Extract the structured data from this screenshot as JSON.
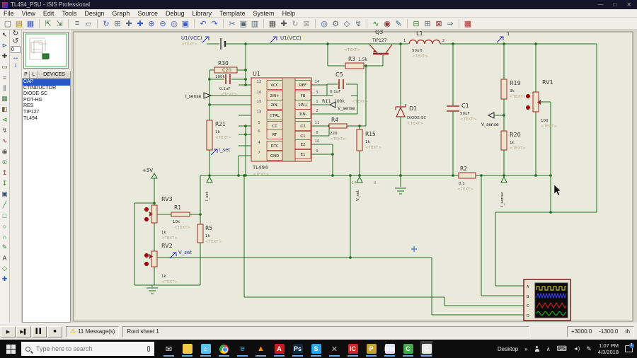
{
  "window": {
    "title": "TL494_PSU - ISIS Professional",
    "controls": {
      "minimize": "—",
      "maximize": "□",
      "close": "✕"
    }
  },
  "menu": {
    "items": [
      "File",
      "View",
      "Edit",
      "Tools",
      "Design",
      "Graph",
      "Source",
      "Debug",
      "Library",
      "Template",
      "System",
      "Help"
    ]
  },
  "toolbar": {
    "icons": [
      {
        "name": "new-design-icon",
        "glyph": "▢"
      },
      {
        "name": "open-design-icon",
        "glyph": "▤",
        "color": "#b58900"
      },
      {
        "name": "save-design-icon",
        "glyph": "▦",
        "color": "#3b5bd0"
      },
      {
        "name": "separator"
      },
      {
        "name": "import-section-icon",
        "glyph": "⇱",
        "color": "#447744"
      },
      {
        "name": "export-section-icon",
        "glyph": "⇲",
        "color": "#447744"
      },
      {
        "name": "separator"
      },
      {
        "name": "print-icon",
        "glyph": "≡"
      },
      {
        "name": "mark-output-area-icon",
        "glyph": "▱"
      },
      {
        "name": "separator"
      },
      {
        "name": "redraw-icon",
        "glyph": "↻",
        "color": "#3b5bd0"
      },
      {
        "name": "toggle-grid-icon",
        "glyph": "⊞"
      },
      {
        "name": "false-origin-icon",
        "glyph": "✚"
      },
      {
        "name": "center-at-cursor-icon",
        "glyph": "✚",
        "color": "#3b5bd0"
      },
      {
        "name": "zoom-in-icon",
        "glyph": "⊕",
        "color": "#3b5bd0"
      },
      {
        "name": "zoom-out-icon",
        "glyph": "⊖",
        "color": "#3b5bd0"
      },
      {
        "name": "zoom-all-icon",
        "glyph": "◎",
        "color": "#3b5bd0"
      },
      {
        "name": "zoom-area-icon",
        "glyph": "▣",
        "color": "#3b5bd0"
      },
      {
        "name": "separator"
      },
      {
        "name": "undo-icon",
        "glyph": "↶",
        "color": "#3b5bd0"
      },
      {
        "name": "redo-icon",
        "glyph": "↷",
        "color": "#3b5bd0"
      },
      {
        "name": "separator"
      },
      {
        "name": "cut-icon",
        "glyph": "✂"
      },
      {
        "name": "copy-icon",
        "glyph": "▣"
      },
      {
        "name": "paste-icon",
        "glyph": "▥"
      },
      {
        "name": "separator"
      },
      {
        "name": "block-copy-icon",
        "glyph": "▦",
        "color": "#555555"
      },
      {
        "name": "block-move-icon",
        "glyph": "✚",
        "color": "#555555"
      },
      {
        "name": "block-rotate-icon",
        "glyph": "↻",
        "color": "#9a9a9a"
      },
      {
        "name": "block-delete-icon",
        "glyph": "⊠",
        "color": "#9a9a9a"
      },
      {
        "name": "separator"
      },
      {
        "name": "pick-parts-icon",
        "glyph": "◎",
        "color": "#3b5bd0"
      },
      {
        "name": "make-device-icon",
        "glyph": "⚙"
      },
      {
        "name": "packaging-tool-icon",
        "glyph": "◇"
      },
      {
        "name": "decompose-icon",
        "glyph": "↯"
      },
      {
        "name": "separator"
      },
      {
        "name": "wire-autorouter-icon",
        "glyph": "∿",
        "color": "#2e8b2e"
      },
      {
        "name": "search-tag-icon",
        "glyph": "◉",
        "color": "#8b2e2e"
      },
      {
        "name": "property-assignment-icon",
        "glyph": "✎",
        "color": "#2e6e8b"
      },
      {
        "name": "separator"
      },
      {
        "name": "design-explorer-icon",
        "glyph": "⊟",
        "color": "#2e8b2e"
      },
      {
        "name": "new-sheet-icon",
        "glyph": "⊞"
      },
      {
        "name": "remove-sheet-icon",
        "glyph": "⊠",
        "color": "#8b2e2e"
      },
      {
        "name": "goto-sheet-icon",
        "glyph": "⇒"
      },
      {
        "name": "separator"
      },
      {
        "name": "netlist-to-ares-icon",
        "glyph": "▦",
        "color": "#c02020"
      }
    ]
  },
  "side_tools": {
    "angle": "0",
    "icons": [
      {
        "name": "rotate-clockwise-icon",
        "glyph": "↻"
      },
      {
        "name": "rotate-anticlockwise-icon",
        "glyph": "↺"
      }
    ],
    "mirror": [
      {
        "name": "mirror-horizontal-icon",
        "glyph": "↔"
      },
      {
        "name": "mirror-vertical-icon",
        "glyph": "↕"
      }
    ]
  },
  "mode_toolbar": {
    "icons": [
      {
        "name": "selection-mode-icon",
        "glyph": "↖",
        "color": "#111111"
      },
      {
        "name": "component-mode-icon",
        "glyph": "⊳",
        "color": "#33507a"
      },
      {
        "name": "junction-dot-icon",
        "glyph": "✚",
        "color": "#444444"
      },
      {
        "name": "wire-label-icon",
        "glyph": "▭",
        "color": "#6a6a3a"
      },
      {
        "name": "text-script-icon",
        "glyph": "≡",
        "color": "#777777"
      },
      {
        "name": "buses-icon",
        "glyph": "∥",
        "color": "#2a55c4"
      },
      {
        "name": "subcircuit-icon",
        "glyph": "▦",
        "color": "#447744"
      },
      {
        "name": "device-icon",
        "glyph": "◧",
        "color": "#7a5a2a"
      },
      {
        "name": "terminal-icon",
        "glyph": "⊲",
        "color": "#2e7d32"
      },
      {
        "name": "device-pin-icon",
        "glyph": "↯",
        "color": "#555555"
      },
      {
        "name": "graph-mode-icon",
        "glyph": "∿",
        "color": "#8b2e2e"
      },
      {
        "name": "tape-recorder-icon",
        "glyph": "◉",
        "color": "#555555"
      },
      {
        "name": "generator-icon",
        "glyph": "⊙",
        "color": "#2e7d32"
      },
      {
        "name": "voltage-probe-icon",
        "glyph": "↥",
        "color": "#8b2e2e"
      },
      {
        "name": "current-probe-icon",
        "glyph": "↧",
        "color": "#2e7d32"
      },
      {
        "name": "virtual-instrument-icon",
        "glyph": "▣",
        "color": "#33507a"
      },
      {
        "name": "2d-line-icon",
        "glyph": "╱",
        "color": "#2e7d32"
      },
      {
        "name": "2d-box-icon",
        "glyph": "□",
        "color": "#2e7d32"
      },
      {
        "name": "2d-circle-icon",
        "glyph": "○",
        "color": "#2e7d32"
      },
      {
        "name": "2d-arc-icon",
        "glyph": "∩",
        "color": "#2e7d32"
      },
      {
        "name": "2d-path-icon",
        "glyph": "✎",
        "color": "#2e7d32"
      },
      {
        "name": "2d-text-icon",
        "glyph": "A",
        "color": "#333333"
      },
      {
        "name": "2d-symbol-icon",
        "glyph": "◇",
        "color": "#2e7d32"
      },
      {
        "name": "2d-marker-icon",
        "glyph": "✚",
        "color": "#2a55c4"
      }
    ]
  },
  "object_selector": {
    "pick_button": "P",
    "library_button": "L",
    "header": "DEVICES",
    "devices": [
      {
        "label": "CAP",
        "selected": true
      },
      {
        "label": "CTINDUCTOR"
      },
      {
        "label": "DIODE-SC"
      },
      {
        "label": "POT-HG"
      },
      {
        "label": "RES"
      },
      {
        "label": "TIP127"
      },
      {
        "label": "TL494"
      }
    ]
  },
  "schematic": {
    "placeholder": "<TEXT>",
    "labels": {
      "vcc_left": "U1(VCC)",
      "vcc_mid": "U1(VCC)",
      "i_sense_in": "I_sense",
      "v_sense_fb": "V_sense",
      "v_sense_out": "V_sense",
      "i_set": "I_set",
      "v_set": "V_set",
      "plus5v": "+5V",
      "out_terminal": "1",
      "t_i_set": "I_set",
      "t_v_set": "V_set",
      "t_i_sense": "I_sense",
      "net8": "8",
      "net14": "14"
    },
    "ic": {
      "ref": "U1",
      "value": "TL494",
      "left_pins": [
        {
          "num": "12",
          "name": "VCC"
        },
        {
          "num": "16",
          "name": "2IN+"
        },
        {
          "num": "15",
          "name": "2IN-"
        },
        {
          "num": "13",
          "name": "CTRL"
        },
        {
          "num": "5",
          "name": "CT"
        },
        {
          "num": "6",
          "name": "RT"
        },
        {
          "num": "4",
          "name": "DTC"
        },
        {
          "num": "7",
          "name": "GND"
        }
      ],
      "right_pins": [
        {
          "num": "14",
          "name": "REF"
        },
        {
          "num": "3",
          "name": "FB"
        },
        {
          "num": "1",
          "name": "1IN+"
        },
        {
          "num": "2",
          "name": "1IN-"
        },
        {
          "num": "11",
          "name": "C2"
        },
        {
          "num": "8",
          "name": "C1"
        },
        {
          "num": "10",
          "name": "E2"
        },
        {
          "num": "9",
          "name": "E1"
        }
      ]
    },
    "components": {
      "R30": {
        "ref": "R30",
        "value": "100k"
      },
      "C20": {
        "ref": "C20",
        "value": "0.1uF"
      },
      "R21": {
        "ref": "R21",
        "value": "1k"
      },
      "Q3": {
        "ref": "Q3",
        "value": "TIP127"
      },
      "R3": {
        "ref": "R3",
        "value": "1.5k"
      },
      "L1": {
        "ref": "L1",
        "value": "50uH",
        "pin1": "1",
        "pin2": "2"
      },
      "C5": {
        "ref": "C5",
        "value": "0.1uF"
      },
      "R11": {
        "ref": "R11",
        "value": "100k"
      },
      "R4": {
        "ref": "R4",
        "value": "220"
      },
      "R15": {
        "ref": "R15",
        "value": "1k"
      },
      "D1": {
        "ref": "D1",
        "value": "DIODE-SC"
      },
      "C1": {
        "ref": "C1",
        "value": "50uF"
      },
      "R19": {
        "ref": "R19",
        "value": "3k"
      },
      "RV1": {
        "ref": "RV1",
        "value": "100"
      },
      "R20": {
        "ref": "R20",
        "value": "1k"
      },
      "R2": {
        "ref": "R2",
        "value": "0.1"
      },
      "RV3": {
        "ref": "RV3",
        "value": "1k"
      },
      "R1": {
        "ref": "R1",
        "value": "10k"
      },
      "R5": {
        "ref": "R5",
        "value": "1k"
      },
      "RV2": {
        "ref": "RV2",
        "value": "1k"
      }
    },
    "oscilloscope": {
      "channels": [
        "A",
        "B",
        "C",
        "D"
      ]
    }
  },
  "status_bar": {
    "sim_buttons": [
      {
        "name": "play-button",
        "glyph": "▶"
      },
      {
        "name": "step-button",
        "glyph": "▶▌"
      },
      {
        "name": "pause-button",
        "glyph": "▌▌"
      },
      {
        "name": "stop-button",
        "glyph": "■"
      }
    ],
    "warning_glyph": "⚠",
    "messages": "11 Message(s)",
    "sheet": "Root sheet 1",
    "coord_x": "+3000.0",
    "coord_y": "-1300.0",
    "coord_units": "th"
  },
  "taskbar": {
    "search": {
      "placeholder": "Type here to search"
    },
    "apps": [
      {
        "name": "mail-icon",
        "glyph": "✉",
        "flat": true,
        "color": "#e8e8e8"
      },
      {
        "name": "file-explorer-icon",
        "glyph": "",
        "color": "#f2c94c"
      },
      {
        "name": "store-icon",
        "glyph": "⌂",
        "color": "#5ec2ee"
      },
      {
        "name": "chrome-icon",
        "glyph": "",
        "chrome": true
      },
      {
        "name": "edge-icon",
        "glyph": "e",
        "flat": true,
        "color": "#35b3e8"
      },
      {
        "name": "vlc-icon",
        "glyph": "▲",
        "flat": true,
        "color": "#ff8f00"
      },
      {
        "name": "acrobat-icon",
        "glyph": "A",
        "color": "#c11f1f"
      },
      {
        "name": "photoshop-icon",
        "glyph": "Ps",
        "color": "#0c2a44"
      },
      {
        "name": "skype-icon",
        "glyph": "S",
        "color": "#28a8ea"
      },
      {
        "name": "directx-icon",
        "glyph": "✕",
        "flat": true,
        "color": "#bbbbbb"
      },
      {
        "name": "ic-app-icon",
        "glyph": "IC",
        "color": "#c62828"
      },
      {
        "name": "proteus-icon",
        "glyph": "P",
        "color": "#caa12c"
      },
      {
        "name": "isis-icon",
        "glyph": "isis",
        "color": "#dfe3f5"
      },
      {
        "name": "camtasia-icon",
        "glyph": "C",
        "color": "#44a948"
      },
      {
        "name": "camtasia-recorder-icon",
        "glyph": "C",
        "color": "#e9e9e9",
        "selected": true
      }
    ],
    "tray": {
      "desktop_label": "Desktop",
      "overflow": "»",
      "chevron": "∧",
      "time": "1:07 PM",
      "date": "4/3/2018",
      "badge": "1"
    }
  }
}
